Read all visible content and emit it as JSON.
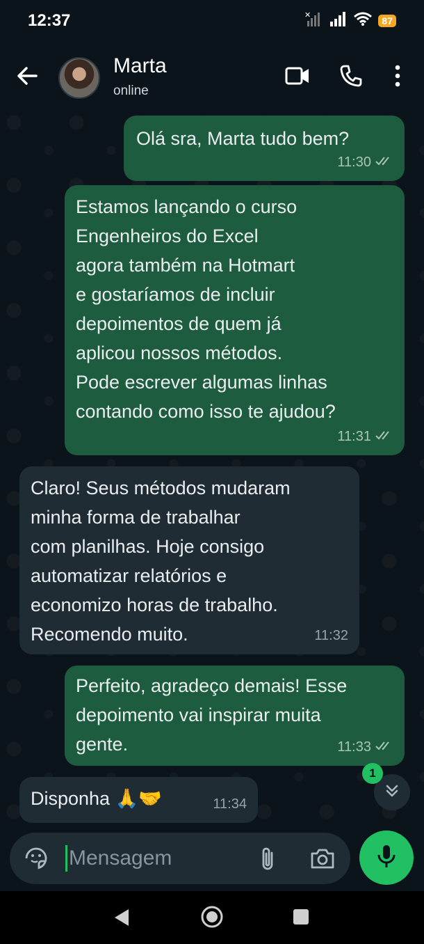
{
  "status_bar": {
    "time": "12:37",
    "battery": "87"
  },
  "header": {
    "name": "Marta",
    "status": "online"
  },
  "messages": [
    {
      "text": "Olá sra,  Marta tudo bem?",
      "time": "11:30"
    },
    {
      "text": "Estamos lançando o curso\nEngenheiros do Excel\nagora também na Hotmart\ne gostaríamos de incluir\ndepoimentos de quem já\naplicou nossos métodos.\nPode escrever algumas linhas\ncontando como isso te ajudou?",
      "time": "11:31"
    },
    {
      "text": "Claro! Seus métodos mudaram\nminha forma de trabalhar\ncom planilhas. Hoje consigo\nautomatizar relatórios e\neconomizo horas de trabalho.\nRecomendo muito.",
      "time": "11:32"
    },
    {
      "text": "Perfeito, agradeço demais! Esse\ndepoimento vai inspirar muita\ngente.",
      "time": "11:33"
    },
    {
      "text": "Disponha 🙏🤝",
      "time": "11:34"
    }
  ],
  "unread_count": "1",
  "input": {
    "placeholder": "Mensagem"
  },
  "colors": {
    "accent": "#21c063",
    "outgoing_bubble": "#1d5c3f",
    "incoming_bubble": "#202c33",
    "background": "#0b141a"
  }
}
